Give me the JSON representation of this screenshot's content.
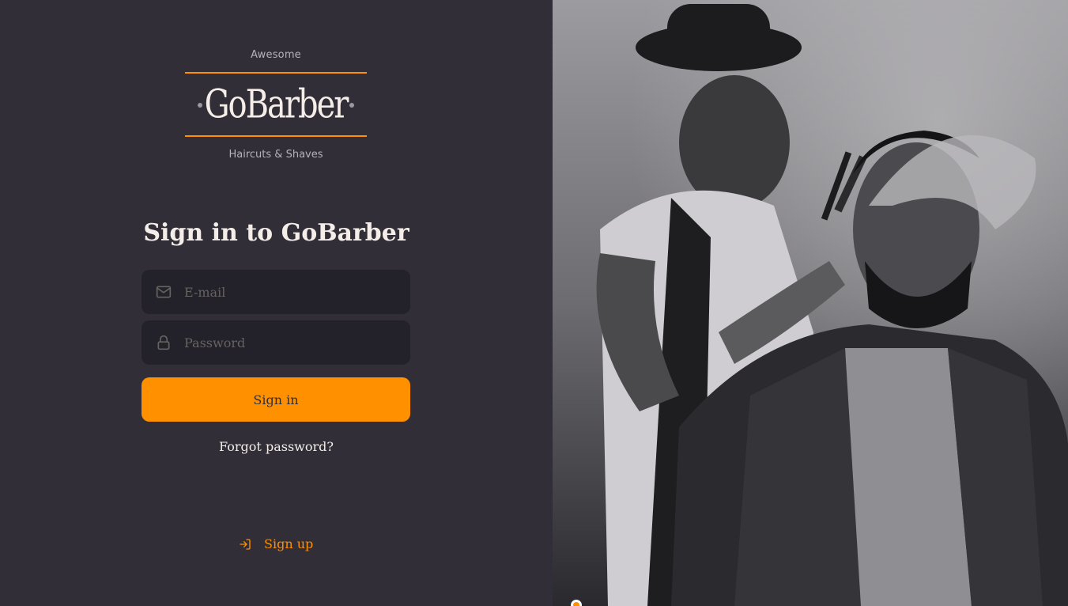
{
  "logo": {
    "top_text": "Awesome",
    "name": "GoBarber",
    "bottom_text": "Haircuts & Shaves"
  },
  "form": {
    "title": "Sign in to GoBarber",
    "email": {
      "placeholder": "E-mail",
      "value": ""
    },
    "password": {
      "placeholder": "Password",
      "value": ""
    },
    "submit_label": "Sign in",
    "forgot_label": "Forgot password?"
  },
  "signup": {
    "label": "Sign up"
  },
  "icons": {
    "email": "mail-icon",
    "password": "lock-icon",
    "signup": "log-in-icon"
  },
  "colors": {
    "background": "#312e38",
    "input_background": "#232129",
    "accent": "#ff9000",
    "text": "#f4ede8",
    "placeholder": "#666360"
  }
}
